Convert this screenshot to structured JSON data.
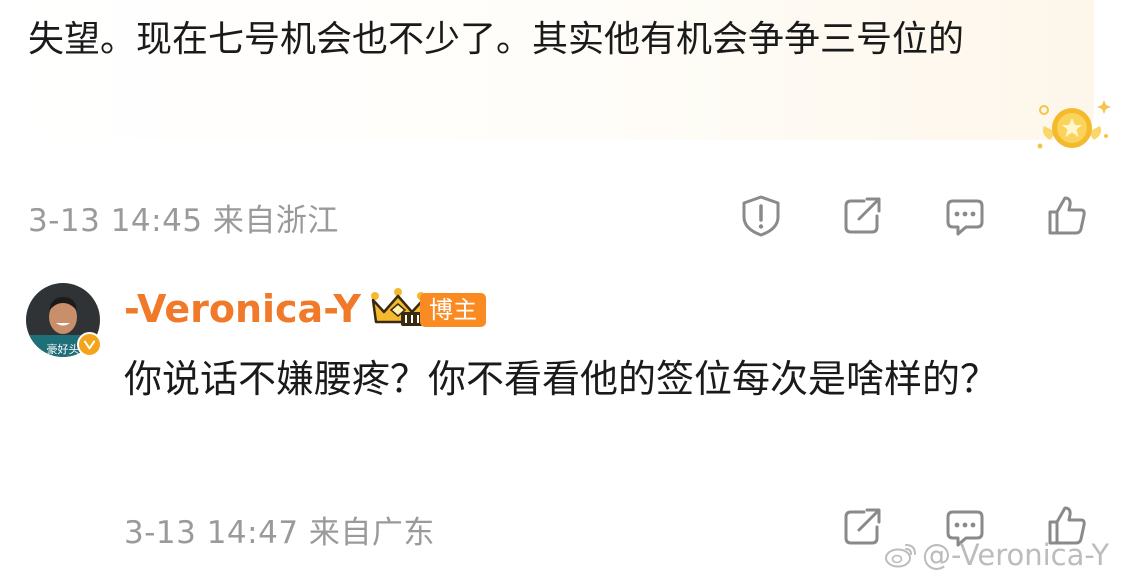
{
  "previous_comment": {
    "text": "失望。现在七号机会也不少了。其实他有机会争争三号位的",
    "meta": "3-13 14:45  来自浙江",
    "icons": [
      "report-icon",
      "share-icon",
      "comment-icon",
      "like-icon"
    ]
  },
  "reply": {
    "username": "-Veronica-Y",
    "badge": "博主",
    "avatar_caption": "豪好头",
    "text": "你说话不嫌腰疼？你不看看他的签位每次是啥样的？",
    "meta": "3-13 14:47  来自广东",
    "icons": [
      "share-icon",
      "comment-icon",
      "like-icon"
    ]
  },
  "watermark": "@-Veronica-Y",
  "colors": {
    "username": "#f07a29",
    "badge_bg": "#fa8a22",
    "meta_text": "#9a9a9a",
    "icon_stroke": "#8a8a8a"
  }
}
